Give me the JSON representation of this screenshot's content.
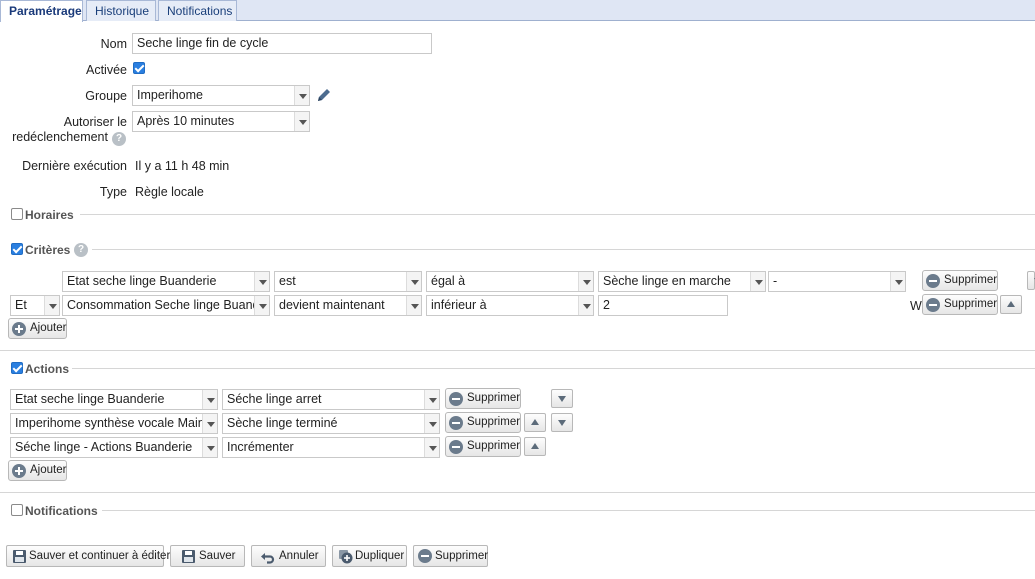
{
  "tabs": [
    "Paramétrage",
    "Historique",
    "Notifications"
  ],
  "form": {
    "name_label": "Nom",
    "name_value": "Seche linge fin de cycle",
    "active_label": "Activée",
    "group_label": "Groupe",
    "group_value": "Imperihome",
    "retrigger_label_line1": "Autoriser le",
    "retrigger_label_line2": "redéclenchement",
    "retrigger_value": "Après 10 minutes",
    "last_exec_label": "Dernière exécution",
    "last_exec_value": "Il y a 11 h 48 min",
    "type_label": "Type",
    "type_value": "Règle locale",
    "help_glyph": "?"
  },
  "sections": {
    "schedules": "Horaires",
    "criteria": "Critères",
    "actions": "Actions",
    "notifications": "Notifications"
  },
  "criteria": {
    "row1": {
      "device": "Etat seche linge Buanderie",
      "verb": "est",
      "operator": "égal à",
      "value": "Sèche linge en marche",
      "unit": "-",
      "delete": "Supprimer"
    },
    "row2": {
      "conjunction": "Et",
      "device": "Consommation Seche linge Buanderie",
      "verb": "devient maintenant",
      "operator": "inférieur à",
      "value": "2",
      "unit": "W",
      "delete": "Supprimer"
    },
    "add": "Ajouter"
  },
  "actions": {
    "row1": {
      "device": "Etat seche linge Buanderie",
      "action": "Séche linge arret",
      "delete": "Supprimer"
    },
    "row2": {
      "device": "Imperihome synthèse vocale Maintenant",
      "action": "Sèche linge terminé",
      "delete": "Supprimer"
    },
    "row3": {
      "device": "Séche linge - Actions Buanderie",
      "action": "Incrémenter",
      "delete": "Supprimer"
    },
    "add": "Ajouter"
  },
  "footer": {
    "save_continue": "Sauver et continuer à éditer",
    "save": "Sauver",
    "cancel": "Annuler",
    "duplicate": "Dupliquer",
    "delete": "Supprimer"
  }
}
